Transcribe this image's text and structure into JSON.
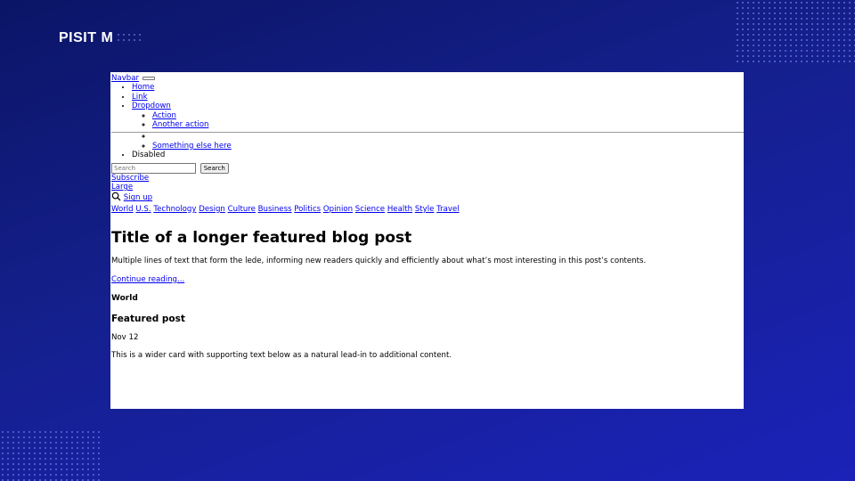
{
  "slide": {
    "brand": "PISIT M"
  },
  "navbar": {
    "brand_link": "Navbar",
    "items": [
      {
        "label": "Home"
      },
      {
        "label": "Link"
      },
      {
        "label": "Dropdown"
      }
    ],
    "dropdown_items": [
      "Action",
      "Another action",
      "Something else here"
    ],
    "disabled_label": "Disabled",
    "search_placeholder": "Search",
    "search_button": "Search"
  },
  "header": {
    "subscribe": "Subscribe",
    "large": "Large",
    "sign_up": "Sign up"
  },
  "categories": [
    "World",
    "U.S.",
    "Technology",
    "Design",
    "Culture",
    "Business",
    "Politics",
    "Opinion",
    "Science",
    "Health",
    "Style",
    "Travel"
  ],
  "featured": {
    "title": "Title of a longer featured blog post",
    "lede": "Multiple lines of text that form the lede, informing new readers quickly and efficiently about what’s most interesting in this post’s contents.",
    "continue": "Continue reading..."
  },
  "card": {
    "category": "World",
    "title": "Featured post",
    "date": "Nov 12",
    "text": "This is a wider card with supporting text below as a natural lead-in to additional content."
  }
}
